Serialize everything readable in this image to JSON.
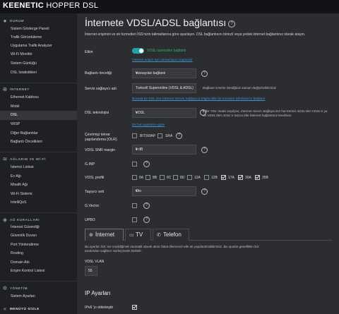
{
  "brand": {
    "logo": "KEENETIC",
    "product": "HOPPER DSL"
  },
  "sidebar": {
    "sections": [
      {
        "title": "DURUM",
        "items": [
          "Sistem Gösterge Paneli",
          "Trafik Görüntüleme",
          "Uygulama Trafik Analyzer",
          "Wi-Fi Monitör",
          "Sistem Günlüğü",
          "DSL İstatistikleri"
        ]
      },
      {
        "title": "İNTERNET",
        "items": [
          "Ethernet Kablosu",
          "Mobil",
          "DSL",
          "WISP",
          "Diğer Bağlantılar",
          "Bağlantı Öncelikleri"
        ]
      },
      {
        "title": "AĞLARIM VE Wİ-Fİ",
        "items": [
          "İstemci Listesi",
          "Ev Ağı",
          "Misafir Ağı",
          "Wi-Fi Sistemi",
          "IntelliQoS"
        ]
      },
      {
        "title": "AĞ KURALLARI",
        "items": [
          "İnternet Güvenliği",
          "Güvenlik Duvarı",
          "Port Yönlendirme",
          "Routing",
          "Domain Adı",
          "Erişim Kontrol Listesi"
        ]
      },
      {
        "title": "YÖNETİM",
        "items": [
          "Sistem Ayarları"
        ]
      }
    ],
    "footer": "MENÜYÜ GİZLE",
    "active": "DSL"
  },
  "page": {
    "title": "İnternete VDSL/ADSL bağlantısı",
    "intro": "İnternet erişimini ve ek hizmetleri İSS'nizin talimatlarına göre ayarlayın. DSL bağlantısını birincil veya yedek internet bağlantınız olarak atayın."
  },
  "form": {
    "enabled": {
      "label": "Etkin",
      "status": "VDSL üzerinden bağlantı",
      "link": "İnternet erişim için zamanlayıcı kapalıdır"
    },
    "priority": {
      "label": "Bağlantı önceliği",
      "value": "Varsayılan bağlantı"
    },
    "provider": {
      "label": "Servis sağlayıcı adı",
      "value": "Turkcell Superonline (VDSL & ADSL)",
      "hint": "Bağlantı isminin istediğiniz zaman değiştirebilirsiniz",
      "link": "Burada bir DSL İSS İnternet Servis Sağlayıcı) bilgisi ekle ile Kurulum Sihirbazı'nı başlatın"
    },
    "dsl_tech": {
      "label": "DSL teknolojisi",
      "value": "VDSL",
      "hint": "Eğer 'Oto' modu seçiliyse, İnternet Servis Sağlayıcınız hat türünü ADSL'den VDSL'e ya da VDSL'den ADSL'e taşısa bile İnternet bağlantınız kesilmez.",
      "link": "Ek hat ayarlarını gizle"
    },
    "retrain": {
      "label": "Çevrimiçi tekrar yapılandırma (OLR)",
      "options": [
        "BITSWAP",
        "SRA"
      ]
    },
    "snr": {
      "label": "VDSL SNR margin",
      "value": "9 dB"
    },
    "ginp": {
      "label": "G.INP"
    },
    "profile": {
      "label": "VDSL profili",
      "options": [
        "8A",
        "8B",
        "8C",
        "8D",
        "12A",
        "12B",
        "17A",
        "30A",
        "35B"
      ],
      "checked": [
        "17A",
        "30A",
        "35B"
      ]
    },
    "carrier": {
      "label": "Taşıyıcı seti",
      "value": "Oto"
    },
    "gvector": {
      "label": "G.Vector"
    },
    "upbo": {
      "label": "UPBO"
    }
  },
  "tabs": [
    {
      "label": "İnternet",
      "icon": "globe-icon"
    },
    {
      "label": "TV",
      "icon": "tv-icon"
    },
    {
      "label": "Telefon",
      "icon": "phone-icon"
    }
  ],
  "tab_note": "Bu ayarlar İSS 'niz seçildiğinde otomatik olarak akıor fakat dilerseniz elle de yapılandırabilirsiniz. Bu ayarlar genellikle İSS tarafından sağlanır sözleşmede belirtilir.",
  "vlan": {
    "label": "VDSL VLAN",
    "value": "55"
  },
  "ip_section": {
    "title": "IP Ayarları",
    "ipv6_label": "IPv6 'yı etkinleştir"
  },
  "colors": {
    "accent": "#23a3a8",
    "link": "#3f93d1",
    "success": "#2fb36b"
  }
}
